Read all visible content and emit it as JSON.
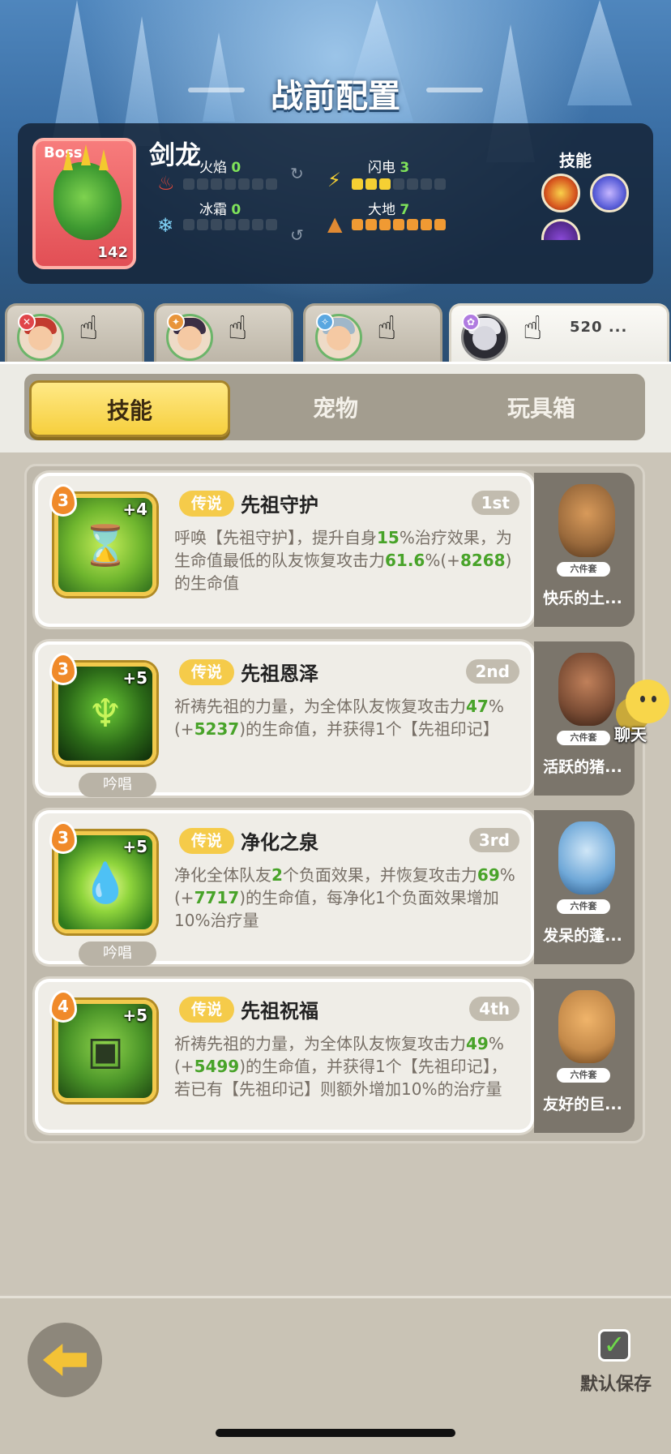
{
  "header": {
    "title": "战前配置"
  },
  "boss": {
    "tag": "Boss",
    "name": "剑龙",
    "level": "142",
    "elements": [
      {
        "label": "火焰",
        "value": "0",
        "icon": "fire-icon"
      },
      {
        "label": "闪电",
        "value": "3",
        "icon": "lightning-icon"
      },
      {
        "label": "冰霜",
        "value": "0",
        "icon": "snowflake-icon"
      },
      {
        "label": "大地",
        "value": "7",
        "icon": "earth-icon"
      }
    ],
    "skills_label": "技能"
  },
  "hero_tabs": [
    {
      "name": "hero-1",
      "badge_color": "#e0454a"
    },
    {
      "name": "hero-2",
      "badge_color": "#e8953a"
    },
    {
      "name": "hero-3",
      "badge_color": "#5aa7e0"
    },
    {
      "name": "hero-4",
      "badge_color": "#b07be0",
      "text": "520 ..."
    }
  ],
  "segment": {
    "tabs": [
      "技能",
      "宠物",
      "玩具箱"
    ],
    "active": 0
  },
  "skills": [
    {
      "level": "3",
      "plus": "+4",
      "rarity": "传说",
      "name": "先祖守护",
      "rank": "1st",
      "desc": [
        {
          "t": "呼唤【先祖守护】，提升自身"
        },
        {
          "t": "15",
          "g": true
        },
        {
          "t": "%治疗效果，为生命值最低的队友恢复攻击力"
        },
        {
          "t": "61.6",
          "g": true
        },
        {
          "t": "%(+"
        },
        {
          "t": "8268",
          "g": true
        },
        {
          "t": ")的生命值"
        }
      ],
      "chant": ""
    },
    {
      "level": "3",
      "plus": "+5",
      "rarity": "传说",
      "name": "先祖恩泽",
      "rank": "2nd",
      "desc": [
        {
          "t": "祈祷先祖的力量，为全体队友恢复攻击力"
        },
        {
          "t": "47",
          "g": true
        },
        {
          "t": "%(+"
        },
        {
          "t": "5237",
          "g": true
        },
        {
          "t": ")的生命值，并获得1个【先祖印记】"
        }
      ],
      "chant": "吟唱"
    },
    {
      "level": "3",
      "plus": "+5",
      "rarity": "传说",
      "name": "净化之泉",
      "rank": "3rd",
      "desc": [
        {
          "t": "净化全体队友"
        },
        {
          "t": "2",
          "g": true
        },
        {
          "t": "个负面效果，并恢复攻击力"
        },
        {
          "t": "69",
          "g": true
        },
        {
          "t": "%(+"
        },
        {
          "t": "7717",
          "g": true
        },
        {
          "t": ")的生命值，每净化1个负面效果增加10%治疗量"
        }
      ],
      "chant": "吟唱"
    },
    {
      "level": "4",
      "plus": "+5",
      "rarity": "传说",
      "name": "先祖祝福",
      "rank": "4th",
      "desc": [
        {
          "t": "祈祷先祖的力量，为全体队友恢复攻击力"
        },
        {
          "t": "49",
          "g": true
        },
        {
          "t": "%(+"
        },
        {
          "t": "5499",
          "g": true
        },
        {
          "t": ")的生命值，并获得1个【先祖印记】，若已有【先祖印记】则额外增加10%的治疗量"
        }
      ],
      "chant": ""
    }
  ],
  "pets": [
    {
      "set": "六件套",
      "name": "快乐的土...",
      "color": "#9a6a3c"
    },
    {
      "set": "六件套",
      "name": "活跃的猪...",
      "color": "#7a4c34"
    },
    {
      "set": "六件套",
      "name": "发呆的蓬...",
      "color": "#6fa8d8"
    },
    {
      "set": "六件套",
      "name": "友好的巨...",
      "color": "#c48a4a"
    }
  ],
  "chat": {
    "label": "聊天"
  },
  "footer": {
    "save_label": "默认保存"
  }
}
